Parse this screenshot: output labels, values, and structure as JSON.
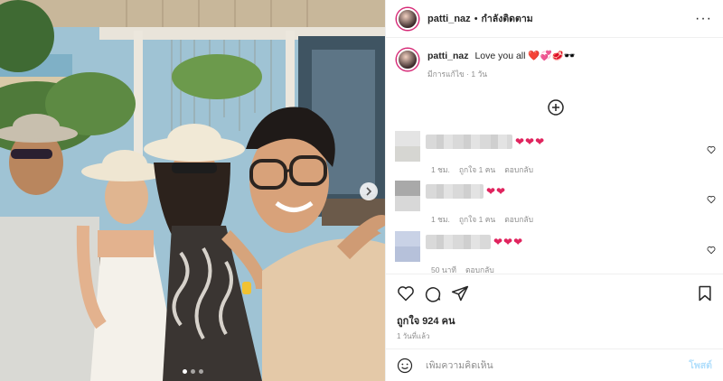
{
  "post": {
    "username": "patti_naz",
    "separator": "•",
    "follow_status": "กำลังติดตาม",
    "more_icon": "more-horizontal-icon"
  },
  "caption": {
    "username": "patti_naz",
    "text": "Love you all ❤️💞🥩🕶️",
    "meta": "มีการแก้ไข · 1 วัน"
  },
  "comments": [
    {
      "hearts": "❤❤❤",
      "time": "1 ชม.",
      "likes": "ถูกใจ 1 คน",
      "reply": "ตอบกลับ"
    },
    {
      "hearts": "❤❤",
      "time": "1 ชม.",
      "likes": "ถูกใจ 1 คน",
      "reply": "ตอบกลับ"
    },
    {
      "hearts": "❤❤❤",
      "time": "50 นาที",
      "likes": "",
      "reply": "ตอบกลับ"
    }
  ],
  "stats": {
    "likes": "ถูกใจ 924 คน",
    "posted": "1 วันที่แล้ว"
  },
  "composer": {
    "placeholder": "เพิ่มความคิดเห็น",
    "post_label": "โพสต์"
  },
  "carousel": {
    "slides": 3,
    "active": 0
  },
  "colors": {
    "accent": "#0095f6",
    "heart": "#e0245e",
    "post_disabled": "#b2dffc"
  }
}
